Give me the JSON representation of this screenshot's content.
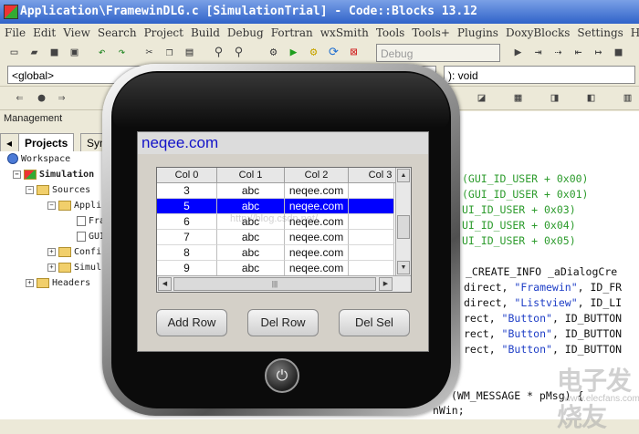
{
  "window": {
    "title": "Application\\FramewinDLG.c [SimulationTrial] - Code::Blocks 13.12"
  },
  "menu": [
    "File",
    "Edit",
    "View",
    "Search",
    "Project",
    "Build",
    "Debug",
    "Fortran",
    "wxSmith",
    "Tools",
    "Tools+",
    "Plugins",
    "DoxyBlocks",
    "Settings",
    "Help"
  ],
  "toolbar": {
    "build_target": "Debug",
    "scope": "<global>",
    "function_sig": "): void"
  },
  "management": {
    "header": "Management",
    "tabs": [
      "Projects",
      "Sym"
    ]
  },
  "tree": [
    {
      "label": "Workspace"
    },
    {
      "label": "Simulation"
    },
    {
      "label": "Sources"
    },
    {
      "label": "Appli"
    },
    {
      "label": "Fra"
    },
    {
      "label": "GUI"
    },
    {
      "label": "Confi"
    },
    {
      "label": "Simul"
    },
    {
      "label": "Headers"
    }
  ],
  "code": [
    {
      "pre": "",
      "green": "(GUI_ID_USER + 0x00)"
    },
    {
      "pre": "",
      "green": "(GUI_ID_USER + 0x01)"
    },
    {
      "pre": "",
      "green": "UI_ID_USER + 0x03)"
    },
    {
      "pre": "",
      "green": "UI_ID_USER + 0x04)"
    },
    {
      "pre": "",
      "green": "UI_ID_USER + 0x05)"
    },
    {
      "pre": "_CREATE_INFO _aDialogCre"
    },
    {
      "pre": "direct, ",
      "blue": "\"Framewin\"",
      "post": ", ID_FR"
    },
    {
      "pre": "direct, ",
      "blue": "\"Listview\"",
      "post": ", ID_LI"
    },
    {
      "pre": "rect, ",
      "blue": "\"Button\"",
      "post": ", ID_BUTTON"
    },
    {
      "pre": "rect, ",
      "blue": "\"Button\"",
      "post": ", ID_BUTTON"
    },
    {
      "pre": "rect, ",
      "blue": "\"Button\"",
      "post": ", ID_BUTTON"
    },
    {
      "pre": "(WM_MESSAGE * pMsg) {"
    },
    {
      "pre": "hWin;"
    }
  ],
  "url_watermark": "http://blog.csdn.net/",
  "watermark": {
    "big": "电子发烧友",
    "small": "www.elecfans.com"
  },
  "device": {
    "frame_title": "neqee.com",
    "listview": {
      "columns": [
        "Col 0",
        "Col 1",
        "Col 2",
        "Col 3"
      ],
      "rows": [
        [
          "3",
          "abc",
          "neqee.com",
          ""
        ],
        [
          "5",
          "abc",
          "neqee.com",
          ""
        ],
        [
          "6",
          "abc",
          "neqee.com",
          ""
        ],
        [
          "7",
          "abc",
          "neqee.com",
          ""
        ],
        [
          "8",
          "abc",
          "neqee.com",
          ""
        ],
        [
          "9",
          "abc",
          "neqee.com",
          ""
        ]
      ],
      "selected_row_index": 1
    },
    "buttons": {
      "add_row": "Add Row",
      "del_row": "Del Row",
      "del_sel": "Del Sel"
    },
    "power_icon": "⏻"
  },
  "colors": {
    "selection": "#0000ff",
    "frame_title_text": "#1313c8",
    "define_green": "#2c9b2c",
    "string_blue": "#1d3dc6"
  }
}
